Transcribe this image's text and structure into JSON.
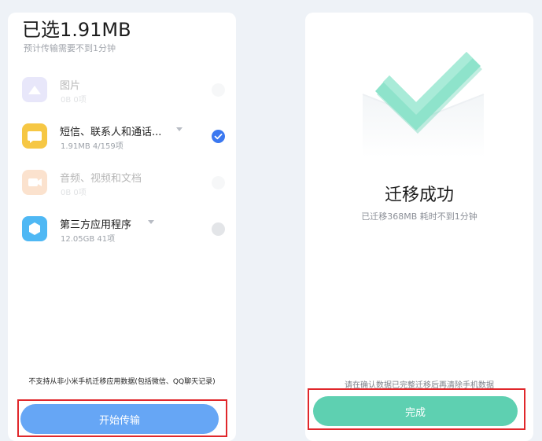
{
  "left": {
    "selected_title": "已选1.91MB",
    "estimate": "预计传输需要不到1分钟",
    "items": [
      {
        "name": "图片",
        "meta": "0B  0项",
        "icon": "image-icon",
        "color": "#b7b4ef",
        "enabled": false,
        "checked": false
      },
      {
        "name": "短信、联系人和通话...",
        "meta": "1.91MB  4/159项",
        "icon": "message-icon",
        "color": "#f6c744",
        "enabled": true,
        "checked": true
      },
      {
        "name": "音频、视频和文档",
        "meta": "0B  0项",
        "icon": "video-icon",
        "color": "#f3a869",
        "enabled": false,
        "checked": false
      },
      {
        "name": "第三方应用程序",
        "meta": "12.05GB  41项",
        "icon": "app-icon",
        "color": "#4fb8f4",
        "enabled": true,
        "checked": false
      }
    ],
    "notice": "不支持从非小米手机迁移应用数据(包括微信、QQ聊天记录)",
    "start_button": "开始传输"
  },
  "right": {
    "success_title": "迁移成功",
    "success_sub": "已迁移368MB 耗时不到1分钟",
    "notice": "请在确认数据已完整迁移后再清除手机数据",
    "done_button": "完成"
  },
  "colors": {
    "accent_blue": "#3b78f0",
    "start_button": "#66a6f5",
    "done_button": "#5ed0b1",
    "highlight": "#e0272b"
  }
}
